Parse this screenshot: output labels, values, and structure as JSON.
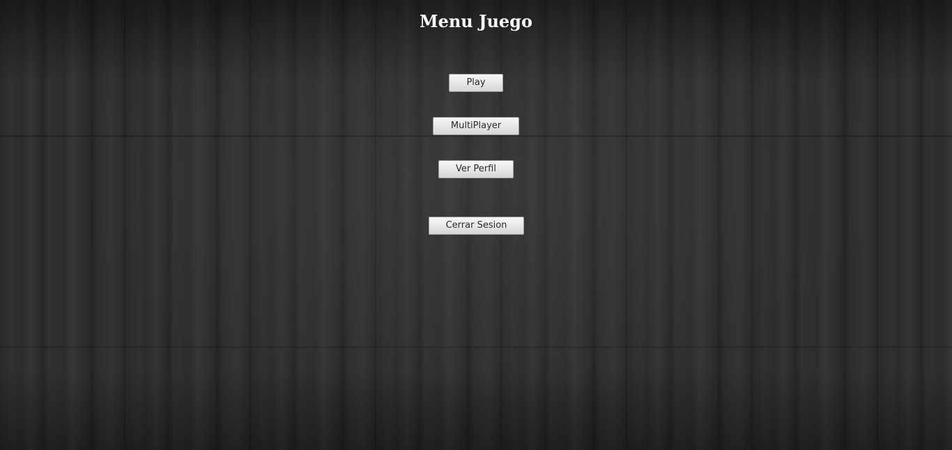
{
  "page": {
    "title": "Menu Juego"
  },
  "menu": {
    "play_label": "Play",
    "multiplayer_label": "MultiPlayer",
    "profile_label": "Ver Perfil",
    "logout_label": "Cerrar Sesion"
  },
  "theme": {
    "background": "dark wood texture",
    "title_color": "#ffffff",
    "button_background": "#e8e8e8",
    "button_text_color": "#2a2a2a"
  }
}
